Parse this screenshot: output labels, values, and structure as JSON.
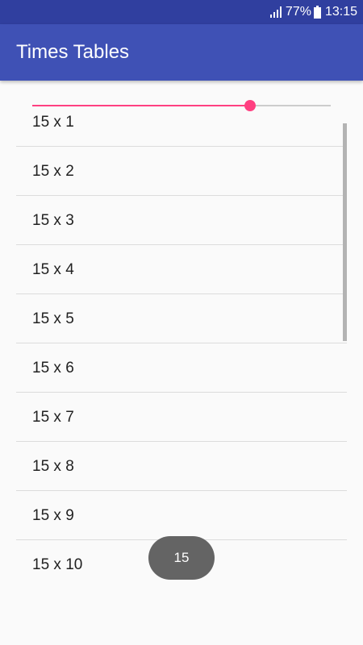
{
  "status_bar": {
    "battery": "77%",
    "time": "13:15"
  },
  "app_bar": {
    "title": "Times Tables",
    "color": "#3f51b5",
    "status_color": "#303f9f"
  },
  "seekbar": {
    "progress": 0.73,
    "accent_color": "#ff4081"
  },
  "list": {
    "items": [
      "15 x 1",
      "15 x 2",
      "15 x 3",
      "15 x 4",
      "15 x 5",
      "15 x 6",
      "15 x 7",
      "15 x 8",
      "15 x 9",
      "15 x 10"
    ]
  },
  "toast": {
    "text": "15"
  }
}
